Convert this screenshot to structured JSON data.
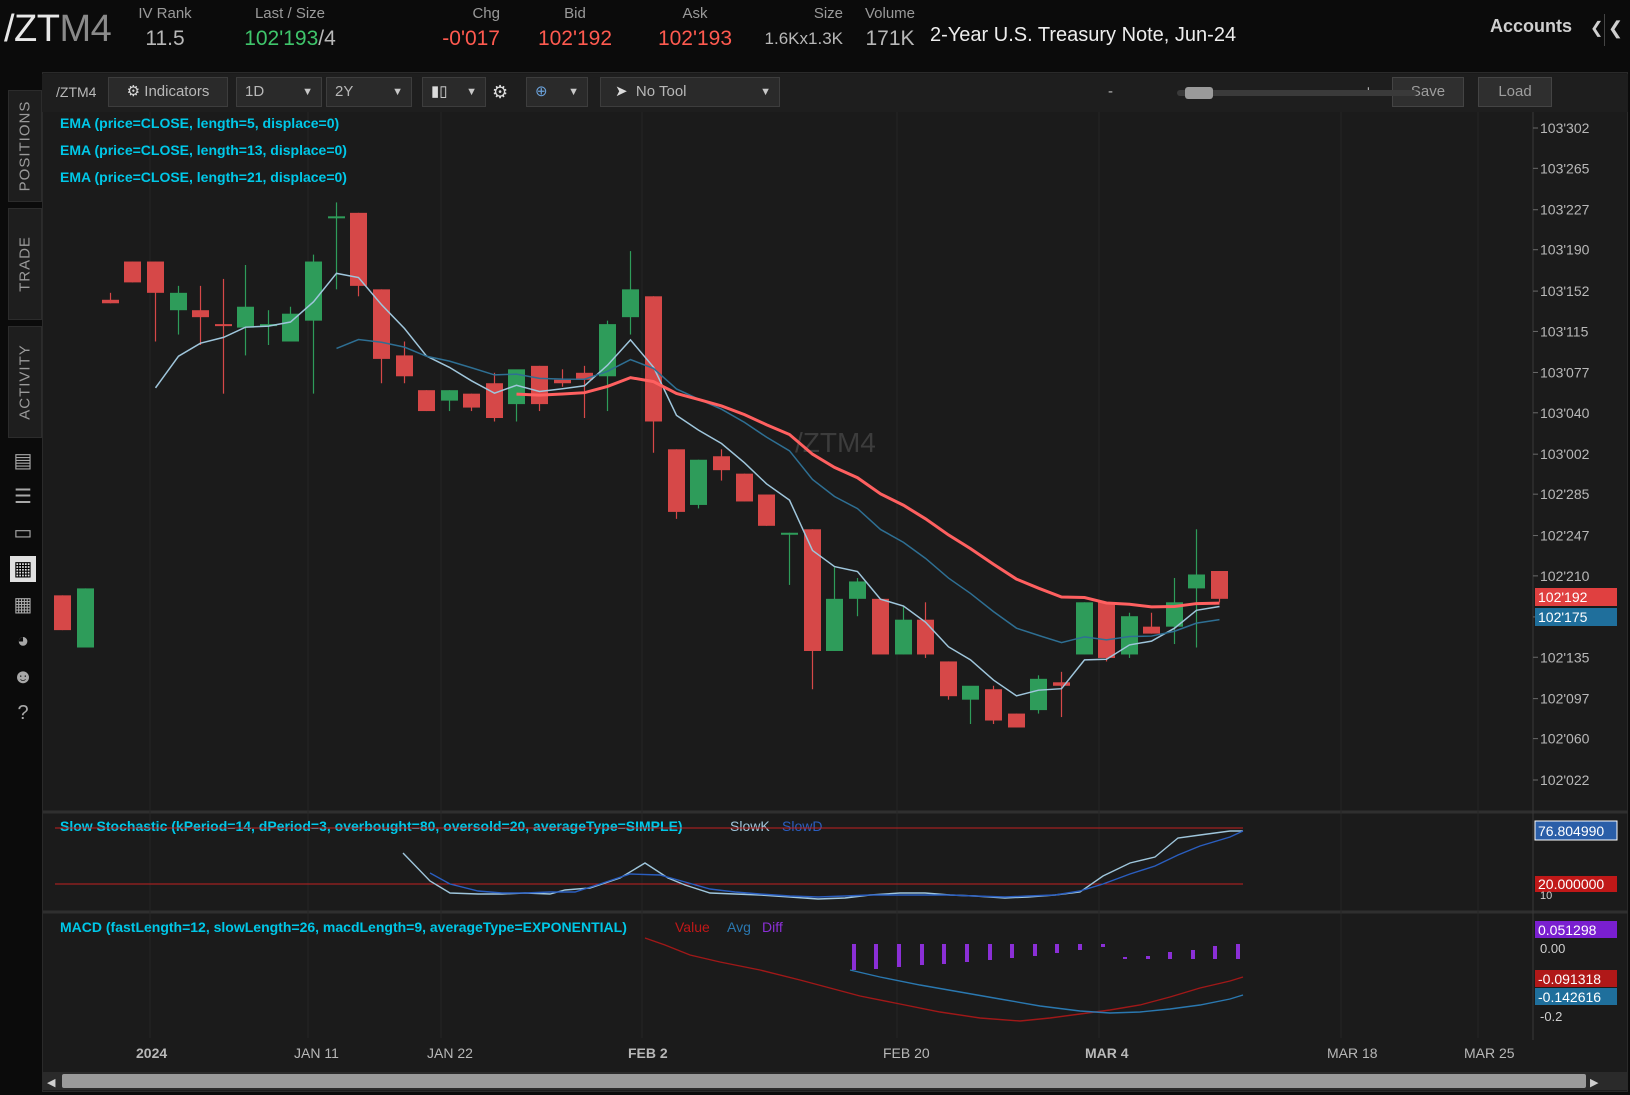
{
  "header": {
    "symbol_main": "/ZT",
    "symbol_suffix": "M4",
    "fields": [
      {
        "label": "IV Rank",
        "value": "11.5",
        "color": "gray"
      },
      {
        "label": "Last / Size",
        "value": "102'193",
        "suffix": "/4",
        "color": "green"
      },
      {
        "label": "Chg",
        "value": "-0'017",
        "color": "red"
      },
      {
        "label": "Bid",
        "value": "102'192",
        "color": "red"
      },
      {
        "label": "Ask",
        "value": "102'193",
        "color": "red"
      },
      {
        "label": "Size",
        "value": "1.6Kx1.3K",
        "color": "gray"
      },
      {
        "label": "Volume",
        "value": "171K",
        "color": "gray"
      }
    ],
    "description": "2-Year U.S. Treasury Note, Jun-24",
    "accounts_label": "Accounts"
  },
  "left_rail": {
    "tabs": [
      "POSITIONS",
      "TRADE",
      "ACTIVITY"
    ],
    "icons": [
      "monitor-icon",
      "list-icon",
      "tv-icon",
      "chart-icon",
      "grid-icon",
      "gauge-icon",
      "people-icon",
      "help-icon"
    ]
  },
  "toolbar": {
    "symbol": "/ZTM4",
    "indicators_label": "Indicators",
    "aggregation": "1D",
    "timeframe": "2Y",
    "drawing_tool": "No Tool",
    "zoom_minus": "-",
    "zoom_plus": "+",
    "save_label": "Save",
    "load_label": "Load"
  },
  "studies": {
    "ema1": "EMA (price=CLOSE, length=5, displace=0)",
    "ema2": "EMA (price=CLOSE, length=13, displace=0)",
    "ema3": "EMA (price=CLOSE, length=21, displace=0)",
    "stoch": "Slow Stochastic (kPeriod=14, dPeriod=3, overbought=80, oversold=20, averageType=SIMPLE)",
    "stoch_k": "SlowK",
    "stoch_d": "SlowD",
    "macd": "MACD (fastLength=12, slowLength=26, macdLength=9, averageType=EXPONENTIAL)",
    "macd_value": "Value",
    "macd_avg": "Avg",
    "macd_diff": "Diff"
  },
  "colors": {
    "up": "#2e9c5a",
    "down": "#d64848",
    "ema5": "#9fc6dc",
    "ema13": "#2e6f93",
    "ema21": "#ff6060",
    "study_text": "#00c8e8",
    "macd_value": "#c01818",
    "macd_avg": "#2a78b0",
    "macd_diff": "#8b2fd6"
  },
  "chart_data": {
    "type": "candlestick",
    "watermark": "/ZTM4",
    "price_ticks": [
      "103'302",
      "103'265",
      "103'227",
      "103'190",
      "103'152",
      "103'115",
      "103'077",
      "103'040",
      "103'002",
      "102'285",
      "102'247",
      "102'210",
      "102'172",
      "102'135",
      "102'097",
      "102'060",
      "102'022"
    ],
    "price_tick_values": [
      103.944,
      103.828,
      103.709,
      103.594,
      103.475,
      103.359,
      103.241,
      103.125,
      103.006,
      102.891,
      102.772,
      102.656,
      102.538,
      102.422,
      102.303,
      102.188,
      102.069
    ],
    "last_price_label": "102'192",
    "ema_price_label": "102'175",
    "x_labels": [
      "2024",
      "JAN 11",
      "JAN 22",
      "FEB 2",
      "FEB 20",
      "MAR 4",
      "MAR 18",
      "MAR 25"
    ],
    "candles": [
      {
        "o": 102.6,
        "h": 102.6,
        "l": 102.5,
        "c": 102.5
      },
      {
        "o": 102.45,
        "h": 102.62,
        "l": 102.45,
        "c": 102.62
      },
      {
        "o": 103.45,
        "h": 103.47,
        "l": 103.44,
        "c": 103.44
      },
      {
        "o": 103.56,
        "h": 103.56,
        "l": 103.5,
        "c": 103.5
      },
      {
        "o": 103.56,
        "h": 103.56,
        "l": 103.33,
        "c": 103.47
      },
      {
        "o": 103.42,
        "h": 103.49,
        "l": 103.35,
        "c": 103.47
      },
      {
        "o": 103.42,
        "h": 103.49,
        "l": 103.32,
        "c": 103.4
      },
      {
        "o": 103.38,
        "h": 103.51,
        "l": 103.18,
        "c": 103.375
      },
      {
        "o": 103.37,
        "h": 103.55,
        "l": 103.29,
        "c": 103.43
      },
      {
        "o": 103.38,
        "h": 103.42,
        "l": 103.32,
        "c": 103.38
      },
      {
        "o": 103.33,
        "h": 103.43,
        "l": 103.36,
        "c": 103.41
      },
      {
        "o": 103.39,
        "h": 103.58,
        "l": 103.18,
        "c": 103.56
      },
      {
        "o": 103.69,
        "h": 103.73,
        "l": 103.48,
        "c": 103.69
      },
      {
        "o": 103.7,
        "h": 103.7,
        "l": 103.46,
        "c": 103.49
      },
      {
        "o": 103.48,
        "h": 103.48,
        "l": 103.21,
        "c": 103.28
      },
      {
        "o": 103.29,
        "h": 103.33,
        "l": 103.21,
        "c": 103.23
      },
      {
        "o": 103.19,
        "h": 103.19,
        "l": 103.13,
        "c": 103.13
      },
      {
        "o": 103.16,
        "h": 103.19,
        "l": 103.13,
        "c": 103.19
      },
      {
        "o": 103.18,
        "h": 103.18,
        "l": 103.13,
        "c": 103.14
      },
      {
        "o": 103.21,
        "h": 103.24,
        "l": 103.1,
        "c": 103.11
      },
      {
        "o": 103.15,
        "h": 103.22,
        "l": 103.1,
        "c": 103.25
      },
      {
        "o": 103.26,
        "h": 103.26,
        "l": 103.13,
        "c": 103.15
      },
      {
        "o": 103.22,
        "h": 103.25,
        "l": 103.2,
        "c": 103.21
      },
      {
        "o": 103.24,
        "h": 103.26,
        "l": 103.11,
        "c": 103.22
      },
      {
        "o": 103.23,
        "h": 103.39,
        "l": 103.13,
        "c": 103.38
      },
      {
        "o": 103.4,
        "h": 103.59,
        "l": 103.35,
        "c": 103.48
      },
      {
        "o": 103.46,
        "h": 103.46,
        "l": 103.01,
        "c": 103.1
      },
      {
        "o": 103.02,
        "h": 103.02,
        "l": 102.82,
        "c": 102.84
      },
      {
        "o": 102.86,
        "h": 102.99,
        "l": 102.85,
        "c": 102.99
      },
      {
        "o": 103.0,
        "h": 103.02,
        "l": 102.93,
        "c": 102.96
      },
      {
        "o": 102.95,
        "h": 102.95,
        "l": 102.87,
        "c": 102.87
      },
      {
        "o": 102.89,
        "h": 102.89,
        "l": 102.8,
        "c": 102.8
      },
      {
        "o": 102.78,
        "h": 102.78,
        "l": 102.63,
        "c": 102.78
      },
      {
        "o": 102.79,
        "h": 102.79,
        "l": 102.33,
        "c": 102.44
      },
      {
        "o": 102.44,
        "h": 102.68,
        "l": 102.44,
        "c": 102.59
      },
      {
        "o": 102.59,
        "h": 102.65,
        "l": 102.54,
        "c": 102.64
      },
      {
        "o": 102.59,
        "h": 102.59,
        "l": 102.46,
        "c": 102.43
      },
      {
        "o": 102.43,
        "h": 102.57,
        "l": 102.43,
        "c": 102.53
      },
      {
        "o": 102.53,
        "h": 102.58,
        "l": 102.42,
        "c": 102.43
      },
      {
        "o": 102.41,
        "h": 102.41,
        "l": 102.3,
        "c": 102.31
      },
      {
        "o": 102.3,
        "h": 102.33,
        "l": 102.23,
        "c": 102.34
      },
      {
        "o": 102.33,
        "h": 102.34,
        "l": 102.23,
        "c": 102.24
      },
      {
        "o": 102.26,
        "h": 102.26,
        "l": 102.22,
        "c": 102.22
      },
      {
        "o": 102.27,
        "h": 102.37,
        "l": 102.26,
        "c": 102.36
      },
      {
        "o": 102.35,
        "h": 102.38,
        "l": 102.25,
        "c": 102.34
      },
      {
        "o": 102.43,
        "h": 102.58,
        "l": 102.43,
        "c": 102.58
      },
      {
        "o": 102.58,
        "h": 102.58,
        "l": 102.41,
        "c": 102.42
      },
      {
        "o": 102.43,
        "h": 102.55,
        "l": 102.42,
        "c": 102.54
      },
      {
        "o": 102.51,
        "h": 102.55,
        "l": 102.49,
        "c": 102.49
      },
      {
        "o": 102.51,
        "h": 102.65,
        "l": 102.46,
        "c": 102.58
      },
      {
        "o": 102.62,
        "h": 102.79,
        "l": 102.45,
        "c": 102.66
      },
      {
        "o": 102.67,
        "h": 102.67,
        "l": 102.58,
        "c": 102.59
      }
    ],
    "stochastic": {
      "overbought": 80,
      "oversold": 20,
      "labels": [
        "76.804990",
        "20.000000"
      ],
      "zero_label": "10"
    },
    "macd": {
      "labels": [
        "0.051298",
        "0.00",
        "-0.091318",
        "-0.142616",
        "-0.2"
      ]
    }
  }
}
